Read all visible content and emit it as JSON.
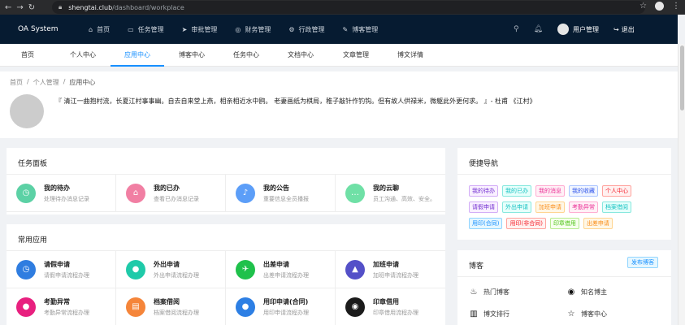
{
  "browser": {
    "url_host": "shengtai.club",
    "url_path": "/dashboard/workplace"
  },
  "header": {
    "brand": "OA System",
    "nav": [
      {
        "icon": "home-icon",
        "glyph": "⌂",
        "label": "首页"
      },
      {
        "icon": "task-icon",
        "glyph": "▭",
        "label": "任务管理"
      },
      {
        "icon": "approve-icon",
        "glyph": "➤",
        "label": "审批管理"
      },
      {
        "icon": "finance-icon",
        "glyph": "◎",
        "label": "财务管理"
      },
      {
        "icon": "admin-icon",
        "glyph": "⚙",
        "label": "行政管理"
      },
      {
        "icon": "blog-icon",
        "glyph": "✎",
        "label": "博客管理"
      }
    ],
    "user_label": "用户管理",
    "logout_label": "退出"
  },
  "subnav": {
    "tabs": [
      "首页",
      "个人中心",
      "应用中心",
      "博客中心",
      "任务中心",
      "文档中心",
      "文章管理",
      "博文详情"
    ],
    "active_index": 2
  },
  "page_header": {
    "breadcrumb": [
      "首页",
      "个人管理",
      "应用中心"
    ],
    "quote": "『 清江一曲抱村流，长夏江村事事幽。自去自来堂上燕，相亲相近水中鸥。 老妻画纸为棋局，稚子敲针作钓钩。但有故人供禄米，微躯此外更何求。 』- 杜甫 《江村》"
  },
  "task_panel": {
    "title": "任务面板",
    "items": [
      {
        "icon": "clock-icon",
        "glyph": "◷",
        "color": "#5cd1a5",
        "title": "我的待办",
        "desc": "处理待办消息记录"
      },
      {
        "icon": "inbox-icon",
        "glyph": "⌂",
        "color": "#f17fa3",
        "title": "我的已办",
        "desc": "查看已办消息记录"
      },
      {
        "icon": "bell-icon",
        "glyph": "♪",
        "color": "#5c9ef8",
        "title": "我的公告",
        "desc": "重要信息全员播报"
      },
      {
        "icon": "chat-icon",
        "glyph": "…",
        "color": "#6fe0a6",
        "title": "我的云聊",
        "desc": "员工沟通、高效、安全。"
      }
    ]
  },
  "common_apps": {
    "title": "常用应用",
    "items": [
      {
        "icon": "leave-clock-icon",
        "glyph": "◷",
        "color": "#2f7de0",
        "title": "请假申请",
        "desc": "请假申请流程办理"
      },
      {
        "icon": "location-icon",
        "glyph": "●",
        "color": "#1fcaa9",
        "title": "外出申请",
        "desc": "外出申请流程办理"
      },
      {
        "icon": "plane-icon",
        "glyph": "✈",
        "color": "#1fc14b",
        "title": "出差申请",
        "desc": "出差申请流程办理"
      },
      {
        "icon": "lamp-icon",
        "glyph": "▲",
        "color": "#5450c8",
        "title": "加班申请",
        "desc": "加班申请流程办理"
      },
      {
        "icon": "person-icon",
        "glyph": "●",
        "color": "#e8207f",
        "title": "考勤异常",
        "desc": "考勤异常流程办理"
      },
      {
        "icon": "archive-icon",
        "glyph": "▤",
        "color": "#f5853a",
        "title": "档案借阅",
        "desc": "档案借阅流程办理"
      },
      {
        "icon": "user-stamp-icon",
        "glyph": "●",
        "color": "#2d7fe4",
        "title": "用印申请(合同)",
        "desc": "用印申请流程办理"
      },
      {
        "icon": "stamp-icon",
        "glyph": "◉",
        "color": "#1b1b1b",
        "title": "印章借用",
        "desc": "印章借用流程办理"
      }
    ]
  },
  "quick_nav": {
    "title": "便捷导航",
    "tags": [
      {
        "label": "我的待办",
        "color": "#722ed1",
        "bg": "#f9f0ff",
        "border": "#d3adf7"
      },
      {
        "label": "我的已办",
        "color": "#13c2c2",
        "bg": "#e6fffb",
        "border": "#87e8de"
      },
      {
        "label": "我的消息",
        "color": "#eb2f96",
        "bg": "#fff0f6",
        "border": "#ffadd2"
      },
      {
        "label": "我的收藏",
        "color": "#2f54eb",
        "bg": "#f0f5ff",
        "border": "#adc6ff"
      },
      {
        "label": "个人中心",
        "color": "#f5222d",
        "bg": "#fff1f0",
        "border": "#ffa39e"
      },
      {
        "label": "请假申请",
        "color": "#722ed1",
        "bg": "#f9f0ff",
        "border": "#d3adf7"
      },
      {
        "label": "外出申请",
        "color": "#13c2c2",
        "bg": "#e6fffb",
        "border": "#87e8de"
      },
      {
        "label": "加班申请",
        "color": "#fa8c16",
        "bg": "#fff7e6",
        "border": "#ffd591"
      },
      {
        "label": "考勤异常",
        "color": "#eb2f96",
        "bg": "#fff0f6",
        "border": "#ffadd2"
      },
      {
        "label": "档案借阅",
        "color": "#13c2c2",
        "bg": "#e6fffb",
        "border": "#87e8de"
      },
      {
        "label": "用印(合同)",
        "color": "#1890ff",
        "bg": "#e6f7ff",
        "border": "#91d5ff"
      },
      {
        "label": "用印(非合同)",
        "color": "#f5222d",
        "bg": "#fff1f0",
        "border": "#ffa39e"
      },
      {
        "label": "印章借用",
        "color": "#52c41a",
        "bg": "#f6ffed",
        "border": "#b7eb8f"
      },
      {
        "label": "出差申请",
        "color": "#fa8c16",
        "bg": "#fff7e6",
        "border": "#ffd591"
      }
    ]
  },
  "blog": {
    "title": "博客",
    "publish_label": "发布博客",
    "links": [
      {
        "icon": "fire-icon",
        "glyph": "♨",
        "label": "热门博客"
      },
      {
        "icon": "broadcast-icon",
        "glyph": "◉",
        "label": "知名博主"
      },
      {
        "icon": "bar-chart-icon",
        "glyph": "▥",
        "label": "博文排行"
      },
      {
        "icon": "star-icon",
        "glyph": "☆",
        "label": "博客中心"
      }
    ]
  }
}
